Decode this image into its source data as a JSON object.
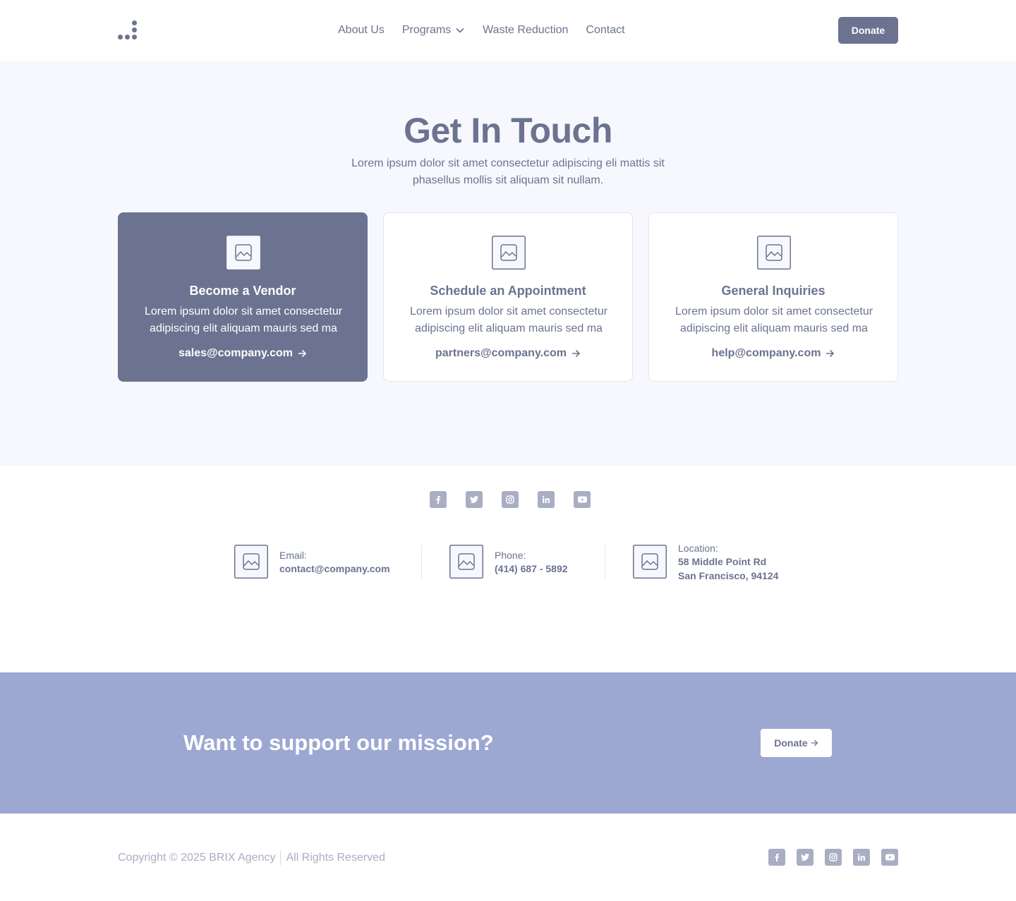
{
  "nav": {
    "links": [
      {
        "label": "About Us"
      },
      {
        "label": "Programs"
      },
      {
        "label": "Waste Reduction"
      },
      {
        "label": "Contact"
      }
    ],
    "donate_label": "Donate"
  },
  "hero": {
    "title": "Get In Touch",
    "subtitle": "Lorem ipsum dolor sit amet consectetur adipiscing eli mattis sit phasellus mollis sit aliquam sit nullam."
  },
  "cards": [
    {
      "title": "Become a Vendor",
      "text": "Lorem ipsum dolor sit amet consectetur adipiscing elit aliquam mauris sed ma",
      "email": "sales@company.com"
    },
    {
      "title": "Schedule an Appointment",
      "text": "Lorem ipsum dolor sit amet consectetur adipiscing elit aliquam mauris sed ma",
      "email": "partners@company.com"
    },
    {
      "title": "General Inquiries",
      "text": "Lorem ipsum dolor sit amet consectetur adipiscing elit aliquam mauris sed ma",
      "email": "help@company.com"
    }
  ],
  "socials": [
    "facebook-icon",
    "twitter-icon",
    "instagram-icon",
    "linkedin-icon",
    "youtube-icon"
  ],
  "contact": {
    "email": {
      "label": "Email:",
      "value": "contact@company.com"
    },
    "phone": {
      "label": "Phone:",
      "value": "(414) 687 - 5892"
    },
    "location": {
      "label": "Location:",
      "line1": "58 Middle Point Rd",
      "line2": "San Francisco, 94124"
    }
  },
  "cta": {
    "title": "Want to support our mission?",
    "button_label": "Donate"
  },
  "footer": {
    "copyright": "Copyright © 2025 BRIX Agency",
    "rights": "All Rights Reserved"
  },
  "colors": {
    "accent": "#6b7390",
    "hero_bg": "#f7f8fd",
    "cta_bg": "#9ca8d2",
    "muted": "#a9aec3"
  }
}
